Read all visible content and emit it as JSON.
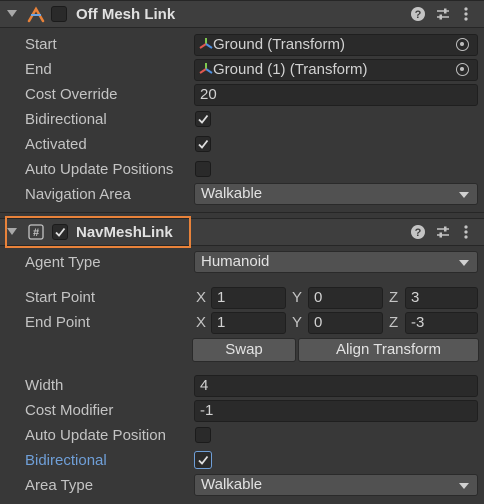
{
  "off_mesh_link": {
    "title": "Off Mesh Link",
    "fields": {
      "start_label": "Start",
      "start_value": "Ground (Transform)",
      "end_label": "End",
      "end_value": "Ground (1) (Transform)",
      "cost_override_label": "Cost Override",
      "cost_override_value": "20",
      "bidirectional_label": "Bidirectional",
      "bidirectional_checked": true,
      "activated_label": "Activated",
      "activated_checked": true,
      "auto_update_label": "Auto Update Positions",
      "auto_update_checked": false,
      "nav_area_label": "Navigation Area",
      "nav_area_value": "Walkable"
    }
  },
  "navmesh_link": {
    "title": "NavMeshLink",
    "highlight_color": "#e8823a",
    "agent_type_label": "Agent Type",
    "agent_type_value": "Humanoid",
    "start_point_label": "Start Point",
    "start_point": {
      "x": "1",
      "y": "0",
      "z": "3"
    },
    "end_point_label": "End Point",
    "end_point": {
      "x": "1",
      "y": "0",
      "z": "-3"
    },
    "axis": {
      "x": "X",
      "y": "Y",
      "z": "Z"
    },
    "swap_label": "Swap",
    "align_label": "Align Transform",
    "width_label": "Width",
    "width_value": "4",
    "cost_modifier_label": "Cost Modifier",
    "cost_modifier_value": "-1",
    "auto_update_label": "Auto Update Position",
    "auto_update_checked": false,
    "bidirectional_label": "Bidirectional",
    "bidirectional_color": "#6f9fd8",
    "bidirectional_checked": true,
    "area_type_label": "Area Type",
    "area_type_value": "Walkable"
  },
  "icons": [
    "foldout-arrow-icon",
    "offmeshlink-component-icon",
    "navmeshlink-script-icon",
    "help-icon",
    "preset-icon",
    "kebab-menu-icon",
    "object-picker-icon",
    "transform-icon",
    "dropdown-arrow-icon",
    "checkmark-icon"
  ]
}
